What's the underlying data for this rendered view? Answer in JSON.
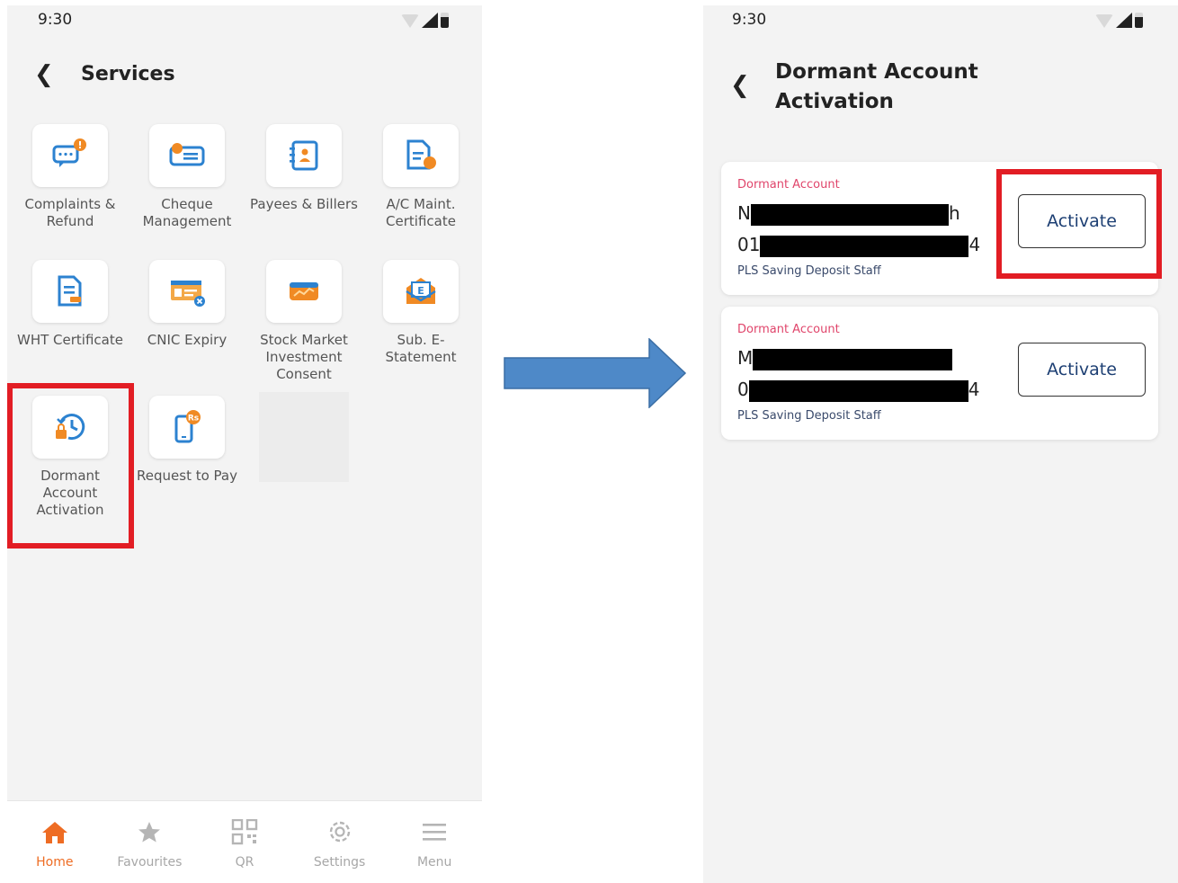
{
  "colors": {
    "accent": "#ee6c23",
    "highlight": "#e21d24",
    "arrow": "#4e89c8",
    "link": "#1d3f73",
    "account_label": "#e0456b"
  },
  "left": {
    "status_time": "9:30",
    "title": "Services",
    "services": [
      {
        "label": "Complaints & Refund",
        "icon": "complaint-icon"
      },
      {
        "label": "Cheque Management",
        "icon": "cheque-icon"
      },
      {
        "label": "Payees & Billers",
        "icon": "payees-icon"
      },
      {
        "label": "A/C Maint. Certificate",
        "icon": "certificate-icon"
      },
      {
        "label": "WHT Certificate",
        "icon": "wht-icon"
      },
      {
        "label": "CNIC Expiry",
        "icon": "cnic-icon"
      },
      {
        "label": "Stock Market Investment Consent",
        "icon": "stock-icon"
      },
      {
        "label": "Sub. E-Statement",
        "icon": "estatement-icon"
      },
      {
        "label": "Dormant Account Activation",
        "icon": "dormant-icon"
      },
      {
        "label": "Request to Pay",
        "icon": "request-pay-icon"
      }
    ],
    "nav": [
      {
        "label": "Home",
        "icon": "home-icon",
        "active": true
      },
      {
        "label": "Favourites",
        "icon": "star-icon"
      },
      {
        "label": "QR",
        "icon": "qr-icon"
      },
      {
        "label": "Settings",
        "icon": "gear-icon"
      },
      {
        "label": "Menu",
        "icon": "menu-icon"
      }
    ]
  },
  "right": {
    "status_time": "9:30",
    "title_line1": "Dormant Account",
    "title_line2": "Activation",
    "accounts": [
      {
        "label": "Dormant Account",
        "name_start": "N",
        "name_end": "h",
        "number_start": "01",
        "number_end": "4",
        "type": "PLS Saving Deposit Staff",
        "button": "Activate"
      },
      {
        "label": "Dormant Account",
        "name_start": "M",
        "name_end": "",
        "number_start": "0",
        "number_end": "4",
        "type": "PLS Saving Deposit Staff",
        "button": "Activate"
      }
    ]
  }
}
